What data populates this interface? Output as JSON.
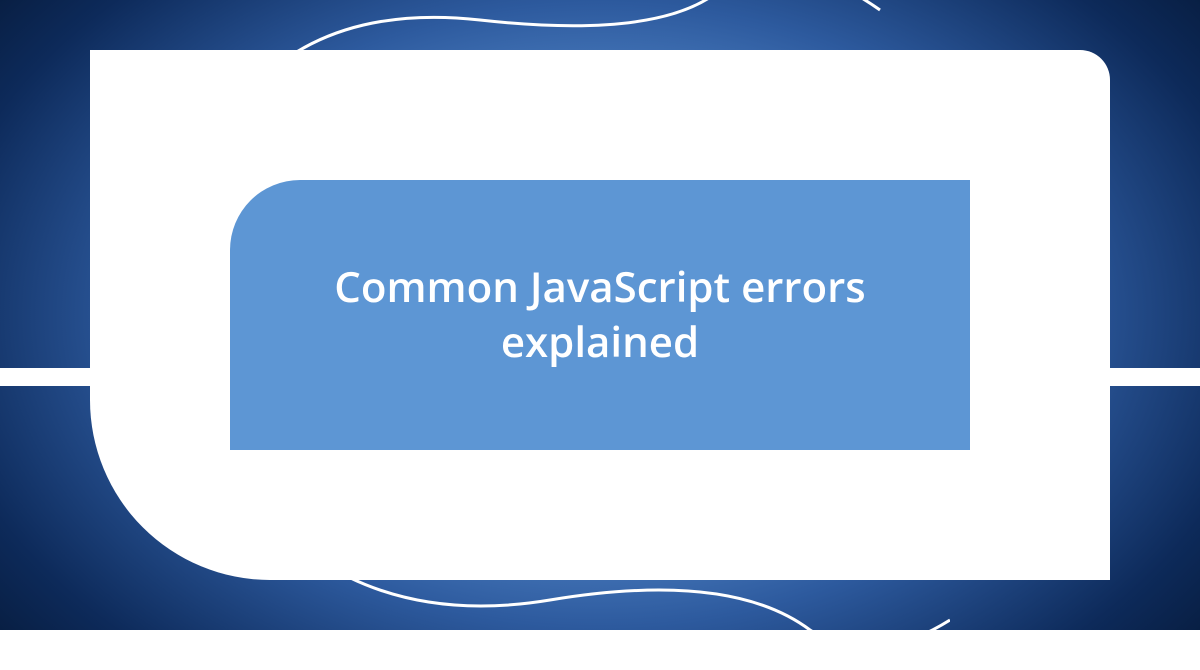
{
  "card": {
    "title": "Common JavaScript errors explained"
  },
  "colors": {
    "bg_dark": "#041530",
    "bg_mid": "#2d5a9e",
    "bg_light": "#6ba3e0",
    "shape_white": "#ffffff",
    "inner_blue": "#5d96d4",
    "text": "#ffffff"
  }
}
